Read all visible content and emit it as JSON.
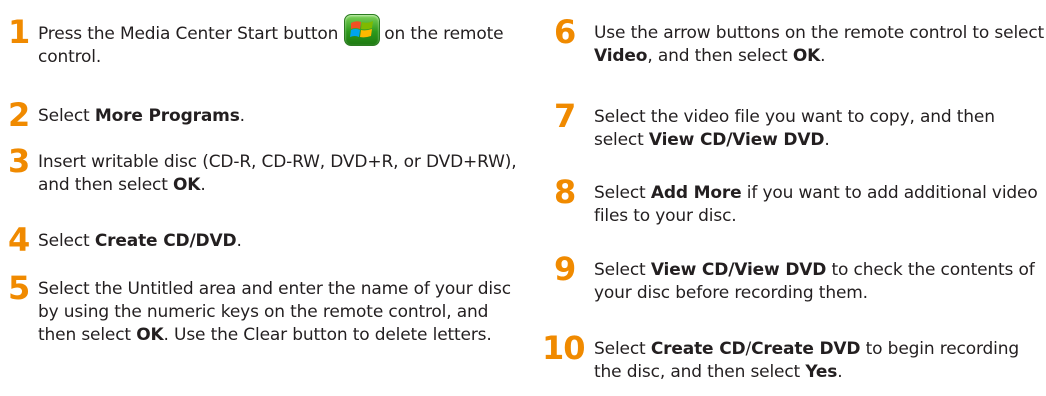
{
  "icons": {
    "start_button": "windows-media-center-start-icon"
  },
  "colors": {
    "step_number": "#f08a00",
    "text": "#231f20"
  },
  "steps": [
    {
      "num": "1",
      "before": "Press the Media Center Start button",
      "after": "on the remote control."
    },
    {
      "num": "2",
      "before": "Select ",
      "b1": "More Programs",
      "after": "."
    },
    {
      "num": "3",
      "before": "Insert writable disc (CD-R, CD-RW, DVD+R, or DVD+RW), and then select ",
      "b1": "OK",
      "after": "."
    },
    {
      "num": "4",
      "before": "Select ",
      "b1": "Create CD/DVD",
      "after": "."
    },
    {
      "num": "5",
      "before": "Select the Untitled area and enter the name of your disc by using the numeric keys on the remote control, and then select ",
      "b1": "OK",
      "after": ". Use the Clear button to delete letters."
    },
    {
      "num": "6",
      "before": "Use the arrow buttons on the remote control to select ",
      "b1": "Video",
      "mid": ", and then select ",
      "b2": "OK",
      "after": "."
    },
    {
      "num": "7",
      "before": "Select the video file you want to copy, and then select ",
      "b1": "View CD/View DVD",
      "after": "."
    },
    {
      "num": "8",
      "before": "Select ",
      "b1": "Add More",
      "after": " if you want to add additional video files to your disc."
    },
    {
      "num": "9",
      "before": "Select ",
      "b1": "View CD/View DVD",
      "after": " to check the contents of your disc before recording them."
    },
    {
      "num": "10",
      "before": "Select ",
      "b1": "Create CD",
      "mid": "/",
      "b2": "Create DVD",
      "mid2": " to begin recording the disc, and then select ",
      "b3": "Yes",
      "after": "."
    }
  ]
}
